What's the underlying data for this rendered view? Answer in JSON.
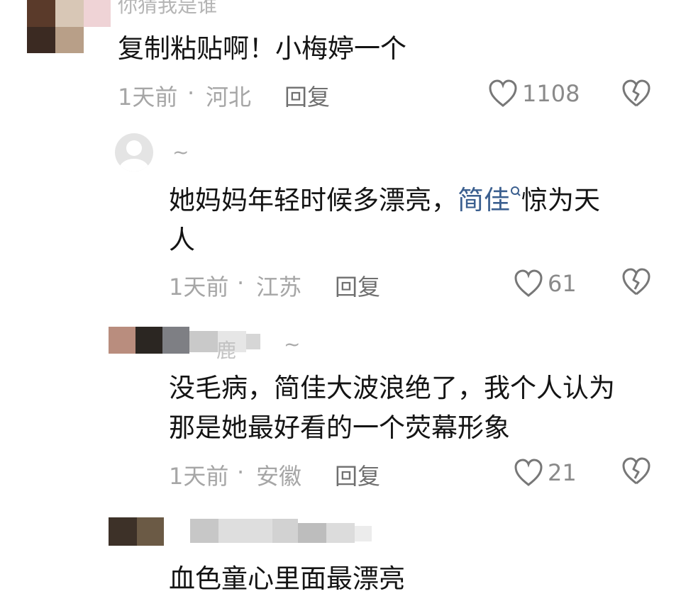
{
  "comments": [
    {
      "username": "你猜我是谁",
      "text": "复制粘贴啊！小梅婷一个",
      "time": "1天前",
      "location": "河北",
      "reply_label": "回复",
      "likes": "1108"
    },
    {
      "username": "~",
      "text_before": "她妈妈年轻时候多漂亮，",
      "link_text": "简佳",
      "text_after": "惊为天",
      "text_line2": "人",
      "time": "1天前",
      "location": "江苏",
      "reply_label": "回复",
      "likes": "61"
    },
    {
      "username": "~",
      "username_partial": "鹿",
      "text_line1": "没毛病，简佳大波浪绝了，我个人认为",
      "text_line2": "那是她最好看的一个荧幕形象",
      "time": "1天前",
      "location": "安徽",
      "reply_label": "回复",
      "likes": "21"
    },
    {
      "text": "血色童心里面最漂亮"
    }
  ],
  "separator": "·",
  "icons": {
    "like": "heart-outline-icon",
    "dislike": "broken-heart-icon",
    "search": "search-icon",
    "avatar": "default-avatar-icon"
  },
  "colors": {
    "link": "#3b5f8f",
    "meta": "#a6a6a6",
    "reply": "#6f6f6f"
  }
}
